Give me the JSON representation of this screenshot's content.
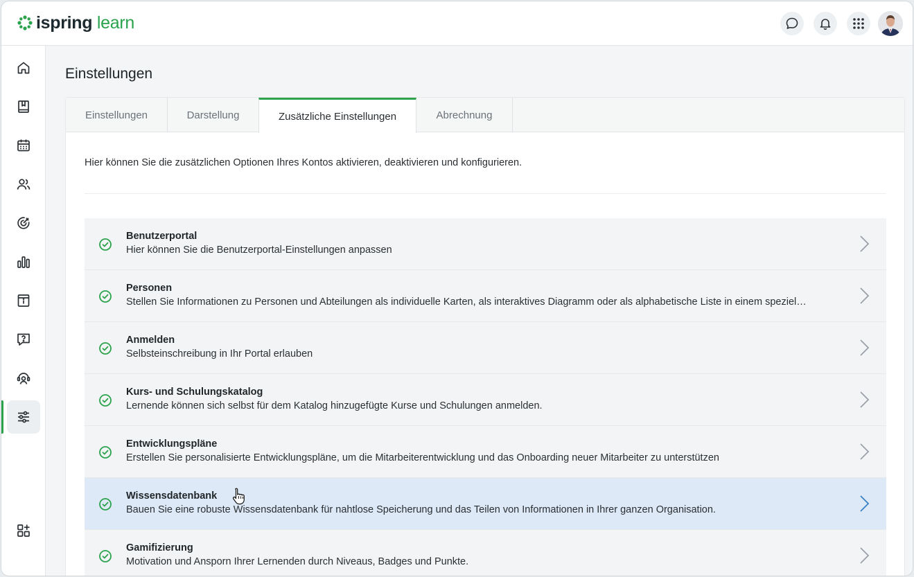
{
  "app": {
    "logo_part1": "ispring",
    "logo_part2": "learn",
    "brand_color": "#2ba24c"
  },
  "header": {
    "icons": [
      "chat-icon",
      "bell-icon",
      "apps-grid-icon"
    ],
    "avatar": "user-avatar"
  },
  "sidebar": {
    "items": [
      {
        "icon": "home-icon"
      },
      {
        "icon": "book-icon"
      },
      {
        "icon": "calendar-icon"
      },
      {
        "icon": "users-icon"
      },
      {
        "icon": "target-icon"
      },
      {
        "icon": "bar-chart-icon"
      },
      {
        "icon": "info-panel-icon"
      },
      {
        "icon": "question-bubble-icon"
      },
      {
        "icon": "support-icon"
      },
      {
        "icon": "settings-sliders-icon",
        "active": true
      },
      {
        "icon": "add-widget-icon"
      }
    ]
  },
  "page": {
    "title": "Einstellungen",
    "tabs": [
      {
        "label": "Einstellungen"
      },
      {
        "label": "Darstellung"
      },
      {
        "label": "Zusätzliche Einstellungen",
        "active": true
      },
      {
        "label": "Abrechnung"
      }
    ],
    "intro": "Hier können Sie die zusätzlichen Optionen Ihres Kontos aktivieren, deaktivieren und konfigurieren."
  },
  "options": [
    {
      "title": "Benutzerportal",
      "desc": "Hier können Sie die Benutzerportal-Einstellungen anpassen"
    },
    {
      "title": "Personen",
      "desc": "Stellen Sie Informationen zu Personen und Abteilungen als individuelle Karten, als interaktives Diagramm oder als alphabetische Liste in einem speziel…"
    },
    {
      "title": "Anmelden",
      "desc": "Selbsteinschreibung in Ihr Portal erlauben"
    },
    {
      "title": "Kurs- und Schulungskatalog",
      "desc": "Lernende können sich selbst für dem Katalog hinzugefügte Kurse und Schulungen anmelden."
    },
    {
      "title": "Entwicklungspläne",
      "desc": "Erstellen Sie personalisierte Entwicklungspläne, um die Mitarbeiterentwicklung und das Onboarding neuer Mitarbeiter zu unterstützen"
    },
    {
      "title": "Wissensdatenbank",
      "desc": "Bauen Sie eine robuste Wissensdatenbank für nahtlose Speicherung und das Teilen von Informationen in Ihrer ganzen Organisation.",
      "hovered": true
    },
    {
      "title": "Gamifizierung",
      "desc": "Motivation und Ansporn Ihrer Lernenden durch Niveaus, Badges und Punkte."
    }
  ]
}
